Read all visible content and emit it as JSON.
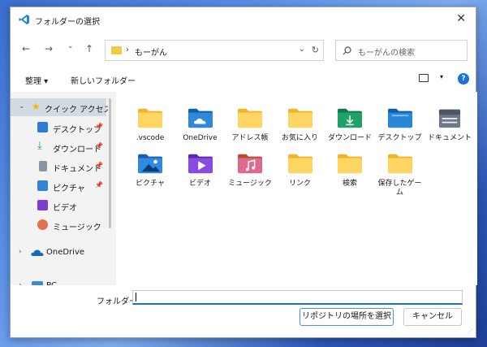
{
  "window": {
    "title": "フォルダーの選択",
    "close": "✕"
  },
  "nav": {
    "back": "←",
    "forward": "→",
    "recent": "⌄",
    "up": "↑",
    "refresh": "↻",
    "path_sep": "›",
    "path": "もーがん",
    "path_chevron": "⌄"
  },
  "search": {
    "placeholder": "もーがんの検索"
  },
  "commands": {
    "organize": "整理 ▾",
    "new_folder": "新しいフォルダー",
    "view_chevron": "▾",
    "help": "?"
  },
  "sidebar": {
    "quick_access": "クイック アクセス",
    "items": [
      {
        "label": "デスクトップ",
        "color": "#2e7bd6"
      },
      {
        "label": "ダウンロード",
        "color": "#21a366"
      },
      {
        "label": "ドキュメント",
        "color": "#7d8596"
      },
      {
        "label": "ピクチャ",
        "color": "#2f86d8"
      },
      {
        "label": "ビデオ",
        "color": "#7a3fd1"
      },
      {
        "label": "ミュージック",
        "color": "#e0704f"
      }
    ],
    "onedrive": "OneDrive",
    "pc": "PC",
    "pin": "📌"
  },
  "files": [
    {
      "name": ".vscode",
      "icon": "folder-icon"
    },
    {
      "name": "OneDrive",
      "icon": "onedrive-folder-icon"
    },
    {
      "name": "アドレス帳",
      "icon": "folder-icon"
    },
    {
      "name": "お気に入り",
      "icon": "folder-icon"
    },
    {
      "name": "ダウンロード",
      "icon": "downloads-folder-icon"
    },
    {
      "name": "デスクトップ",
      "icon": "desktop-folder-icon"
    },
    {
      "name": "ドキュメント",
      "icon": "documents-folder-icon"
    },
    {
      "name": "ピクチャ",
      "icon": "pictures-folder-icon"
    },
    {
      "name": "ビデオ",
      "icon": "videos-folder-icon"
    },
    {
      "name": "ミュージック",
      "icon": "music-folder-icon"
    },
    {
      "name": "リンク",
      "icon": "folder-icon"
    },
    {
      "name": "検索",
      "icon": "folder-icon"
    },
    {
      "name": "保存したゲーム",
      "icon": "folder-icon"
    }
  ],
  "footer": {
    "folder_label": "フォルダー:",
    "folder_value": "",
    "select_button": "リポジトリの場所を選択",
    "cancel_button": "キャンセル"
  }
}
